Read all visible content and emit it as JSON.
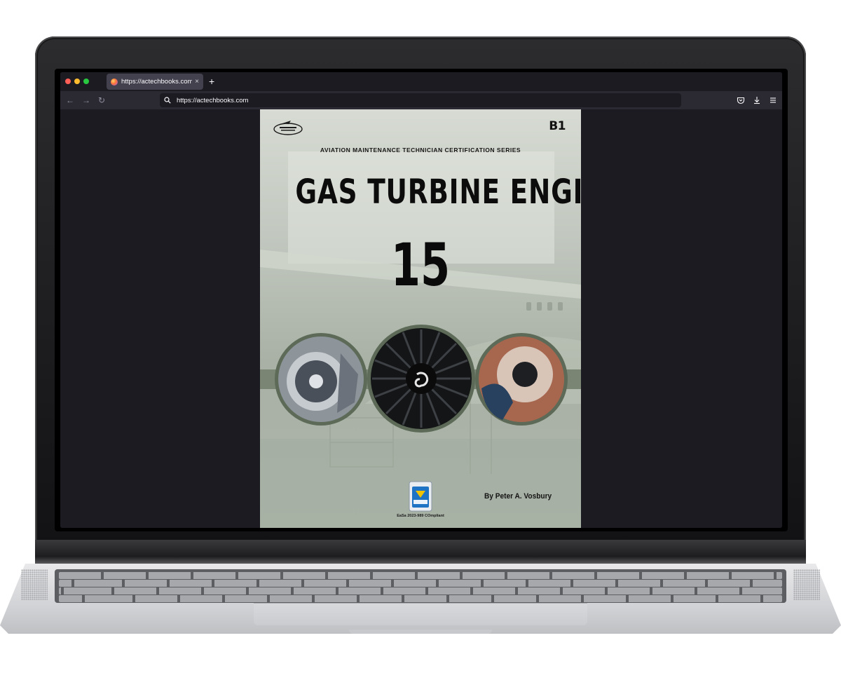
{
  "browser": {
    "tab": {
      "title": "https://actechbooks.com",
      "close_glyph": "×"
    },
    "new_tab_glyph": "+",
    "nav": {
      "back_glyph": "←",
      "forward_glyph": "→",
      "reload_glyph": "↻"
    },
    "url": "https://actechbooks.com",
    "toolbar_icons": [
      "pocket-icon",
      "download-icon",
      "menu-icon"
    ],
    "colors": {
      "window_bg": "#1c1b22",
      "toolbar_bg": "#2b2a33",
      "tab_bg": "#42414d"
    }
  },
  "cover": {
    "logo": "aircraft-technical-book-company-logo",
    "grade": "B1",
    "series": "AVIATION MAINTENANCE TECHNICIAN CERTIFICATION SERIES",
    "title": "GAS TURBINE ENGINE",
    "module": "15",
    "badge": "easa-compliant-badge",
    "badge_caption": "EaSa 2023-989 COmpliant",
    "author": "By Peter A. Vosbury",
    "colors": {
      "band": "#7a8573",
      "title": "#0c0c0c"
    }
  }
}
